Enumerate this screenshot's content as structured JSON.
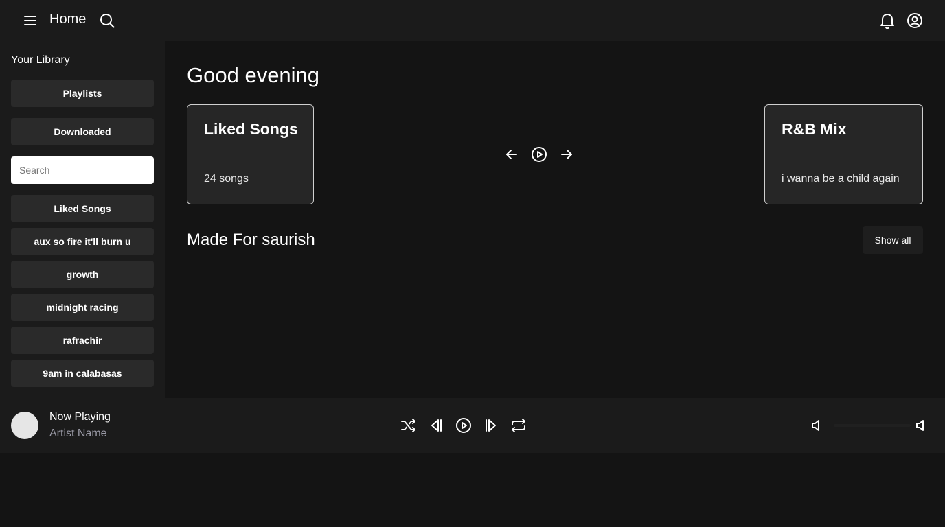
{
  "header": {
    "title": "Home",
    "icons": [
      "menu-icon",
      "search-icon",
      "bell-icon",
      "user-circle-icon"
    ]
  },
  "sidebar": {
    "title": "Your Library",
    "buttons": [
      {
        "label": "Playlists"
      },
      {
        "label": "Downloaded"
      }
    ],
    "search": {
      "placeholder": "Search",
      "value": ""
    },
    "playlists": [
      {
        "label": "Liked Songs"
      },
      {
        "label": "aux so fire it'll burn u"
      },
      {
        "label": "growth"
      },
      {
        "label": "midnight racing"
      },
      {
        "label": "rafrachir"
      },
      {
        "label": "9am in calabasas"
      }
    ]
  },
  "main": {
    "greeting": "Good evening",
    "cards": [
      {
        "title": "Liked Songs",
        "subtitle": "24 songs"
      },
      {
        "title": "R&B Mix",
        "subtitle": "i wanna be a child again"
      }
    ],
    "carousel_icons": [
      "arrow-left-icon",
      "play-circle-icon",
      "arrow-right-icon"
    ],
    "section": {
      "title": "Made For saurish",
      "action": "Show all"
    }
  },
  "player": {
    "title": "Now Playing",
    "artist": "Artist Name",
    "controls": [
      "shuffle-icon",
      "skip-back-icon",
      "play-circle-icon",
      "skip-forward-icon",
      "repeat-icon"
    ],
    "volume_level": 0.0
  },
  "colors": {
    "background": "#141414",
    "panel": "#1b1b1b",
    "button": "#2a2a2a",
    "card": "#262626",
    "muted_text": "#9a9aa6"
  }
}
